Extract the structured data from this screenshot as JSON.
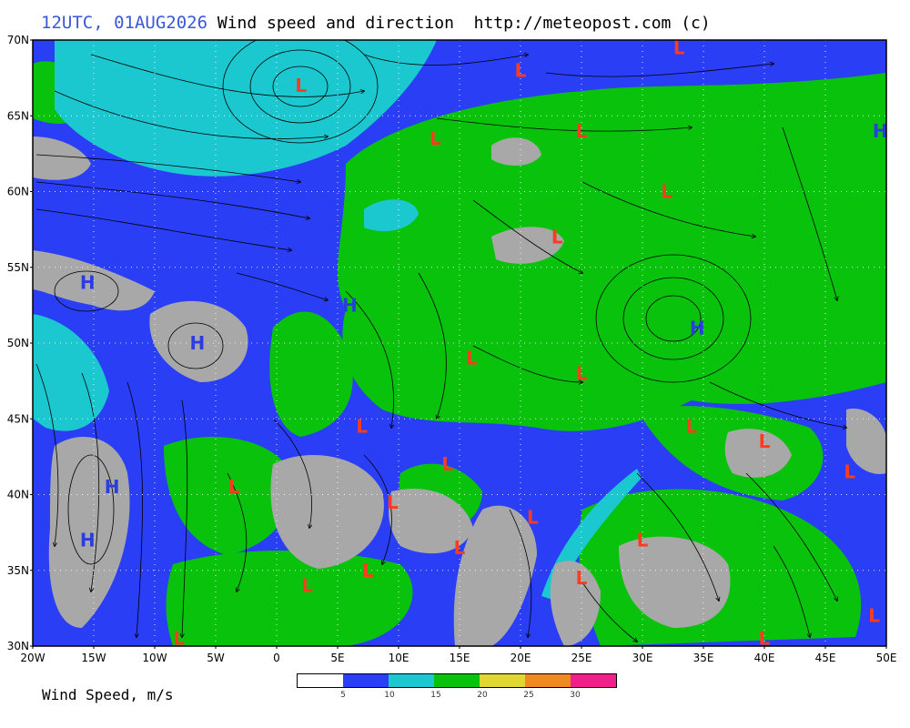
{
  "header": {
    "time": "12UTC, 01AUG2026",
    "rest": " Wind speed and direction  http://meteopost.com (c)"
  },
  "map": {
    "lat_labels": [
      "70N",
      "65N",
      "60N",
      "55N",
      "50N",
      "45N",
      "40N",
      "35N",
      "30N"
    ],
    "lon_labels": [
      "20W",
      "15W",
      "10W",
      "5W",
      "0",
      "5E",
      "10E",
      "15E",
      "20E",
      "25E",
      "30E",
      "35E",
      "40E",
      "45E",
      "50E"
    ],
    "lat_range": [
      30,
      70
    ],
    "lon_range": [
      -20,
      50
    ],
    "grid": "dotted",
    "pressure_centers": [
      {
        "type": "L",
        "lon": 2,
        "lat": 67
      },
      {
        "type": "L",
        "lon": 13,
        "lat": 63.5
      },
      {
        "type": "L",
        "lon": 20,
        "lat": 68
      },
      {
        "type": "L",
        "lon": 33,
        "lat": 69.5
      },
      {
        "type": "L",
        "lon": 25,
        "lat": 64
      },
      {
        "type": "L",
        "lon": 32,
        "lat": 60
      },
      {
        "type": "L",
        "lon": 23,
        "lat": 57
      },
      {
        "type": "L",
        "lon": 16,
        "lat": 49
      },
      {
        "type": "L",
        "lon": 25,
        "lat": 48
      },
      {
        "type": "L",
        "lon": 7,
        "lat": 44.5
      },
      {
        "type": "L",
        "lon": 34,
        "lat": 44.5
      },
      {
        "type": "L",
        "lon": 40,
        "lat": 43.5
      },
      {
        "type": "L",
        "lon": 47,
        "lat": 41.5
      },
      {
        "type": "L",
        "lon": 14,
        "lat": 42
      },
      {
        "type": "L",
        "lon": -3.5,
        "lat": 40.5
      },
      {
        "type": "L",
        "lon": 9.5,
        "lat": 39.5
      },
      {
        "type": "L",
        "lon": 21,
        "lat": 38.5
      },
      {
        "type": "L",
        "lon": 30,
        "lat": 37
      },
      {
        "type": "L",
        "lon": 15,
        "lat": 36.5
      },
      {
        "type": "L",
        "lon": 7.5,
        "lat": 35
      },
      {
        "type": "L",
        "lon": 2.5,
        "lat": 34
      },
      {
        "type": "L",
        "lon": 25,
        "lat": 34.5
      },
      {
        "type": "L",
        "lon": -8,
        "lat": 30.5
      },
      {
        "type": "L",
        "lon": 40,
        "lat": 30.5
      },
      {
        "type": "L",
        "lon": 49,
        "lat": 32
      },
      {
        "type": "H",
        "lon": -15.5,
        "lat": 54
      },
      {
        "type": "H",
        "lon": -6.5,
        "lat": 50
      },
      {
        "type": "H",
        "lon": 6,
        "lat": 52.5
      },
      {
        "type": "H",
        "lon": -13.5,
        "lat": 40.5
      },
      {
        "type": "H",
        "lon": -15.5,
        "lat": 37
      },
      {
        "type": "H",
        "lon": 34.5,
        "lat": 51
      },
      {
        "type": "H",
        "lon": 49.5,
        "lat": 64
      }
    ]
  },
  "legend": {
    "title": "Wind Speed, m/s",
    "colors": [
      "#ffffff",
      "#2a3ef5",
      "#1cc8d0",
      "#08c20c",
      "#e0d830",
      "#f08a20",
      "#f0208a"
    ],
    "ticks": [
      "5",
      "10",
      "15",
      "20",
      "25",
      "30"
    ]
  }
}
